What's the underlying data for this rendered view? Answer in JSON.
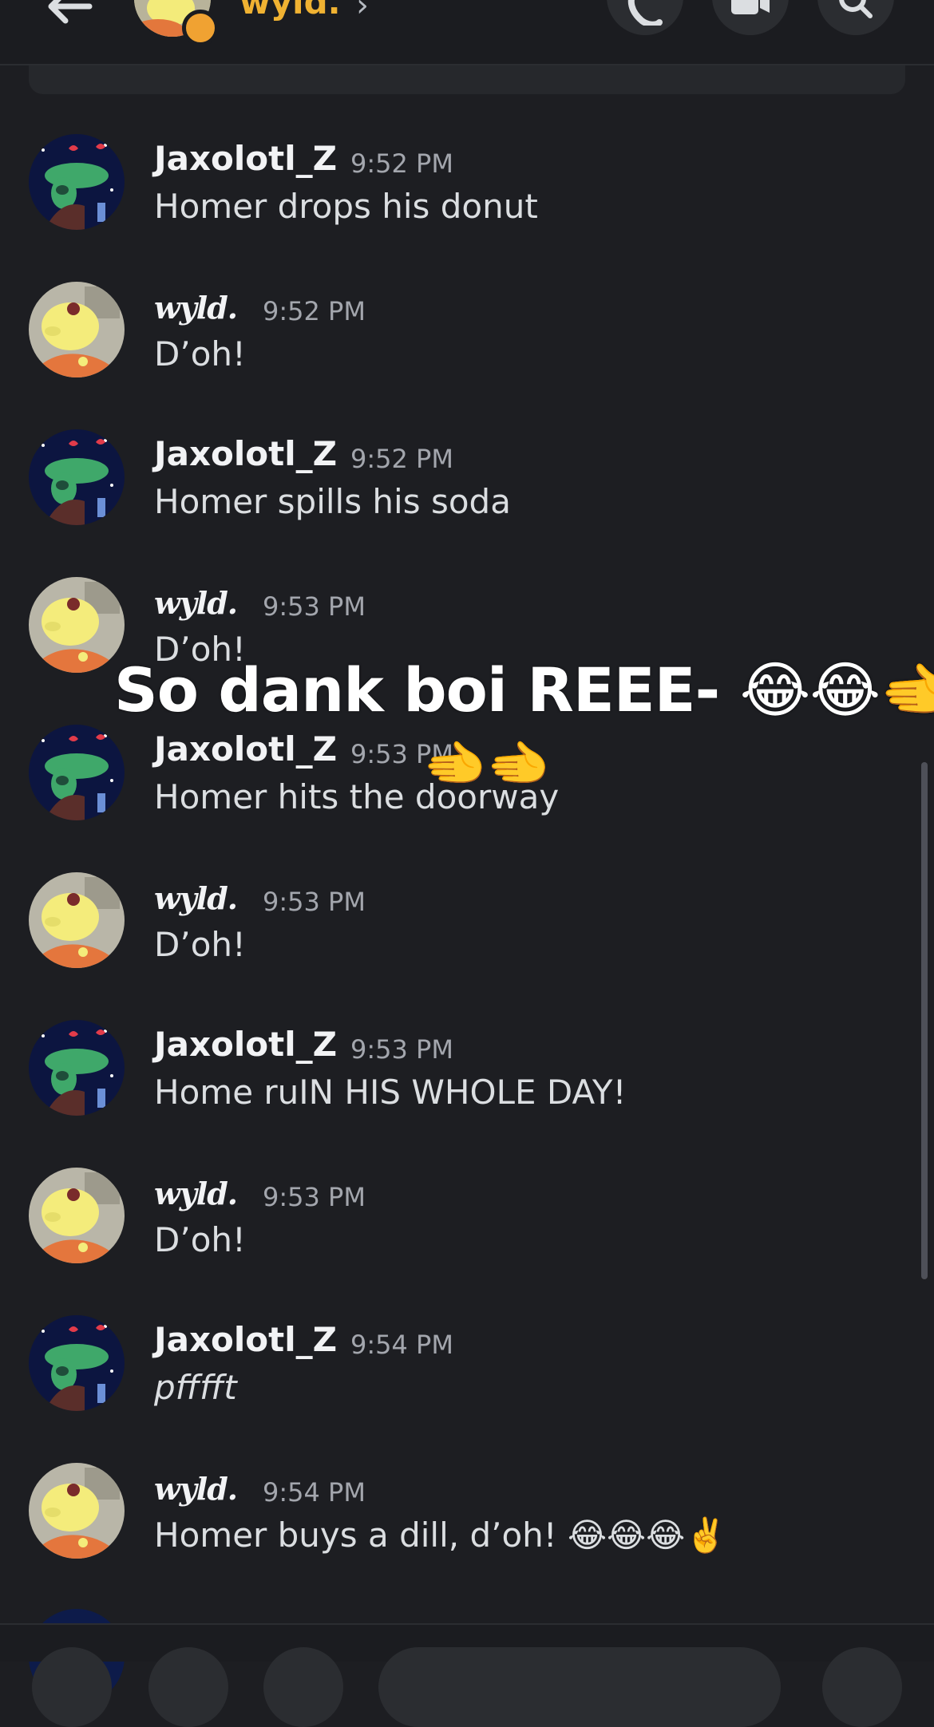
{
  "header": {
    "channel_name": "wyld.",
    "chevron": "›",
    "icons": [
      "back-arrow-icon",
      "phone-icon",
      "video-icon",
      "search-icon"
    ]
  },
  "messages": [
    {
      "author": "Jaxolotl_Z",
      "time": "9:52 PM",
      "text": "Homer drops his donut",
      "avatar": "jaxolotl"
    },
    {
      "author": "wyld.",
      "time": "9:52 PM",
      "text": "D’oh!",
      "avatar": "wyld"
    },
    {
      "author": "Jaxolotl_Z",
      "time": "9:52 PM",
      "text": "Homer spills his soda",
      "avatar": "jaxolotl"
    },
    {
      "author": "wyld.",
      "time": "9:53 PM",
      "text": "D’oh!",
      "avatar": "wyld"
    },
    {
      "author": "Jaxolotl_Z",
      "time": "9:53 PM",
      "text": "Homer hits the doorway",
      "avatar": "jaxolotl"
    },
    {
      "author": "wyld.",
      "time": "9:53 PM",
      "text": "D’oh!",
      "avatar": "wyld"
    },
    {
      "author": "Jaxolotl_Z",
      "time": "9:53 PM",
      "text": "Home ruIN HIS WHOLE DAY!",
      "avatar": "jaxolotl"
    },
    {
      "author": "wyld.",
      "time": "9:53 PM",
      "text": "D’oh!",
      "avatar": "wyld"
    },
    {
      "author": "Jaxolotl_Z",
      "time": "9:54 PM",
      "text": "pfffft",
      "avatar": "jaxolotl"
    },
    {
      "author": "wyld.",
      "time": "9:54 PM",
      "text": "Homer buys a dill, d’oh! 😂😂😂✌️",
      "avatar": "wyld"
    }
  ],
  "overlay": {
    "line1": "So dank boi REEE- 😂😂🫲",
    "line2": "🫲🫲"
  }
}
